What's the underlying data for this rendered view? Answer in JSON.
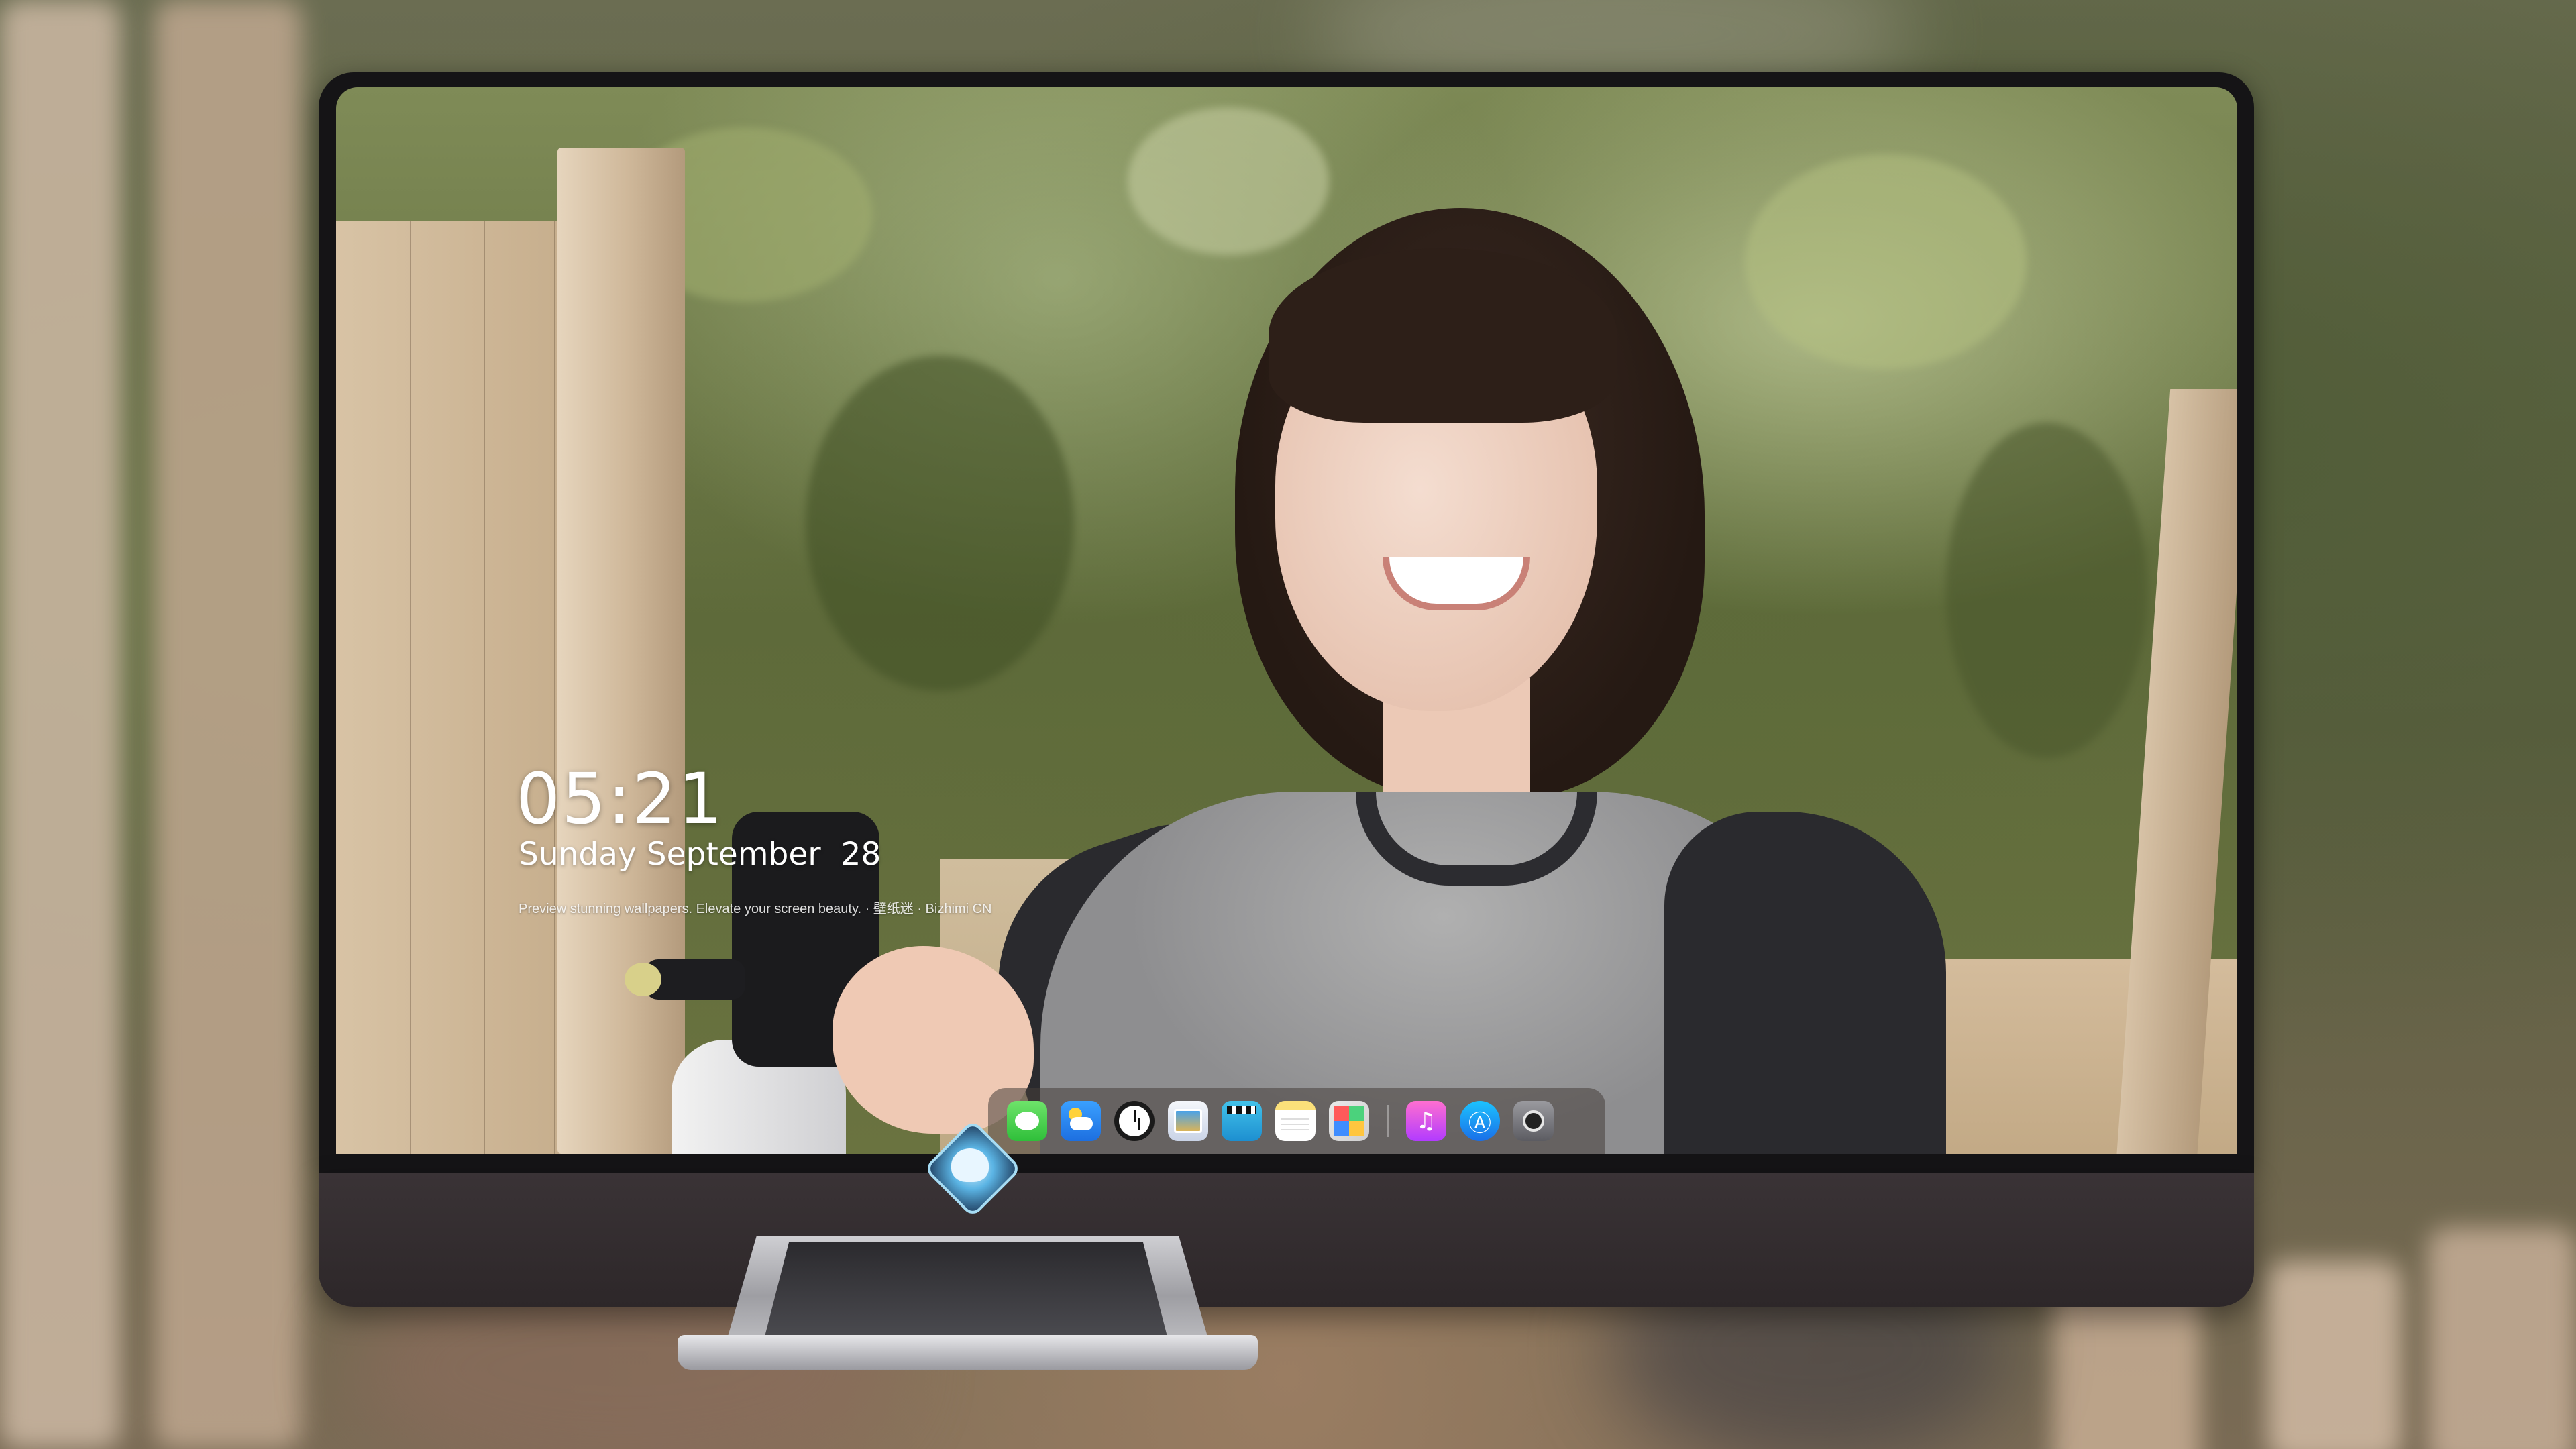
{
  "desktop": {
    "clock": {
      "time": "05:21",
      "date": "Sunday September  28",
      "tagline": "Preview stunning wallpapers. Elevate your screen beauty. · 壁纸迷 · Bizhimi CN"
    }
  },
  "dock": {
    "apps": [
      {
        "name": "Messages",
        "icon": "messages-icon"
      },
      {
        "name": "Weather",
        "icon": "weather-icon"
      },
      {
        "name": "Clock",
        "icon": "clock-icon"
      },
      {
        "name": "Preview",
        "icon": "preview-icon"
      },
      {
        "name": "Clips",
        "icon": "clips-icon"
      },
      {
        "name": "Notes",
        "icon": "notes-icon"
      },
      {
        "name": "Photo Booth",
        "icon": "photo-booth-icon"
      },
      {
        "name": "Music",
        "icon": "music-icon"
      },
      {
        "name": "App Store",
        "icon": "app-store-icon"
      },
      {
        "name": "Camera",
        "icon": "camera-icon"
      }
    ],
    "glyphs": {
      "music": "♫",
      "appstore": "Ⓐ"
    }
  },
  "colors": {
    "bezel": "#151416",
    "chin": "#3a3336",
    "dock_bg": "rgba(70,62,58,.55)",
    "text": "#ffffff"
  }
}
